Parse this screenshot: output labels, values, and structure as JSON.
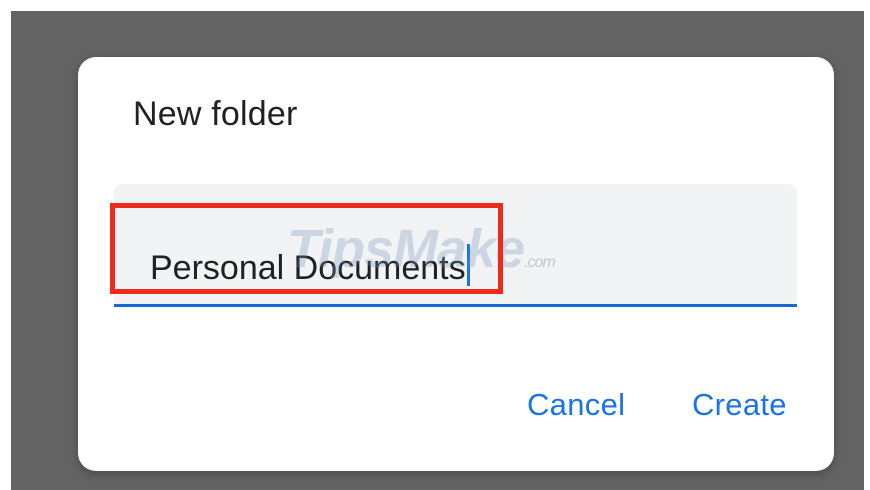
{
  "dialog": {
    "title": "New folder",
    "field": {
      "value": "Personal Documents"
    },
    "buttons": {
      "cancel_label": "Cancel",
      "create_label": "Create"
    }
  },
  "watermark": {
    "main": "TipsMake",
    "suffix": ".com"
  },
  "colors": {
    "accent": "#1a73e8",
    "highlight": "#ee2b1b",
    "backdrop": "#636363",
    "field_bg": "#f1f3f4"
  }
}
